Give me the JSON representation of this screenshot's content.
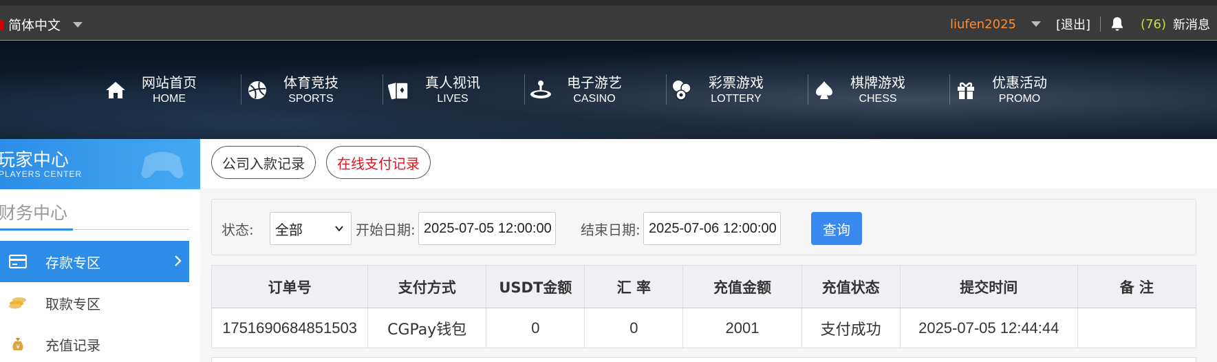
{
  "topbar": {
    "language": "简体中文",
    "username": "liufen2025",
    "logout": "[退出]",
    "message_count": "(76)",
    "message_label": "新消息"
  },
  "nav": [
    {
      "cn": "网站首页",
      "en": "HOME",
      "icon": "home-icon"
    },
    {
      "cn": "体育竞技",
      "en": "SPORTS",
      "icon": "ball-icon"
    },
    {
      "cn": "真人视讯",
      "en": "LIVES",
      "icon": "cards-icon"
    },
    {
      "cn": "电子游艺",
      "en": "CASINO",
      "icon": "joystick-icon"
    },
    {
      "cn": "彩票游戏",
      "en": "LOTTERY",
      "icon": "lottery-balls-icon"
    },
    {
      "cn": "棋牌游戏",
      "en": "CHESS",
      "icon": "spade-icon"
    },
    {
      "cn": "优惠活动",
      "en": "PROMO",
      "icon": "gift-icon"
    }
  ],
  "sidebar": {
    "title_cn": "玩家中心",
    "title_en": "PLAYERS CENTER",
    "section_title": "财务中心",
    "items": [
      {
        "label": "存款专区",
        "icon": "card-icon",
        "active": true
      },
      {
        "label": "取款专区",
        "icon": "coins-icon",
        "active": false
      },
      {
        "label": "充值记录",
        "icon": "money-bag-icon",
        "active": false
      }
    ]
  },
  "tabs": {
    "company_deposit": "公司入款记录",
    "online_payment": "在线支付记录"
  },
  "filter": {
    "status_label": "状态:",
    "status_value": "全部",
    "start_label": "开始日期:",
    "start_value": "2025-07-05 12:00:00",
    "end_label": "结束日期:",
    "end_value": "2025-07-06 12:00:00",
    "search_button": "查询"
  },
  "table": {
    "headers": [
      "订单号",
      "支付方式",
      "USDT金额",
      "汇 率",
      "充值金额",
      "充值状态",
      "提交时间",
      "备 注"
    ],
    "rows": [
      [
        "1751690684851503",
        "CGPay钱包",
        "0",
        "0",
        "2001",
        "支付成功",
        "2025-07-05 12:44:44",
        ""
      ]
    ]
  }
}
